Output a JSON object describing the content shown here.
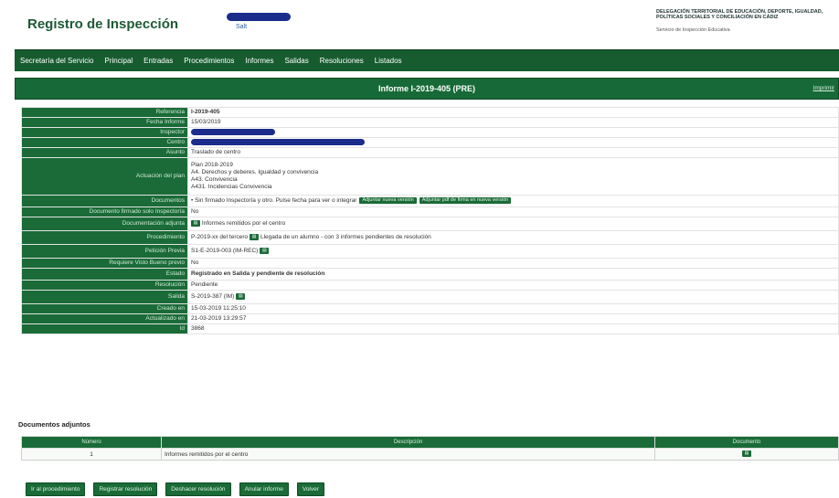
{
  "app": {
    "title": "Registro de Inspección",
    "logo_text": "Salt",
    "org_name": "DELEGACIÓN TERRITORIAL DE EDUCACIÓN, DEPORTE, IGUALDAD, POLÍTICAS SOCIALES Y CONCILIACIÓN EN CÁDIZ",
    "org_sub": "Servicio de Inspección Educativa"
  },
  "nav": [
    "Secretaría del Servicio",
    "Principal",
    "Entradas",
    "Procedimientos",
    "Informes",
    "Salidas",
    "Resoluciones",
    "Listados"
  ],
  "report": {
    "title": "Informe I-2019-405 (PRE)",
    "header_link": "Imprimir"
  },
  "fields": {
    "referencia": {
      "label": "Referencia",
      "value": "I-2019-405"
    },
    "fecha": {
      "label": "Fecha Informe",
      "value": "15/03/2019"
    },
    "inspector": {
      "label": "Inspector"
    },
    "centro": {
      "label": "Centro"
    },
    "asunto": {
      "label": "Asunto",
      "value": "Traslado de centro"
    },
    "actuacion": {
      "label": "Actuación del plan",
      "lines": [
        "Plan 2018-2019",
        "A4. Derechos y deberes. Igualdad y convivencia",
        "A43. Convivencia",
        "A431. Incidencias Convivencia"
      ]
    },
    "documentos": {
      "label": "Documentos",
      "value": "• Sin firmado Inspectoría y otro. Pulse fecha para ver o integrar",
      "btn1": "Adjuntar nueva versión",
      "btn2": "Adjuntar pdf de firma en nueva versión"
    },
    "doc_firmado": {
      "label": "Documento firmado solo Inspectoría",
      "value": "No"
    },
    "doc_adjuntos": {
      "label": "Documentación adjunta",
      "value": "Informes remitidos por el centro"
    },
    "procedimiento": {
      "label": "Procedimiento",
      "value": "P-2019-xx del tercero",
      "tail": "Llegada de un alumno - con 3 informes pendientes de resolución"
    },
    "peticion": {
      "label": "Petición Previa",
      "value": "S1-E-2019-003 (IM-REC)"
    },
    "visto_bueno": {
      "label": "Requiere Visto Bueno previo",
      "value": "No"
    },
    "estado": {
      "label": "Estado",
      "value": "Registrado en Salida y pendiente de resolución"
    },
    "resolucion": {
      "label": "Resolución",
      "value": "Pendiente"
    },
    "salida": {
      "label": "Salida",
      "value": "S-2019-387 (IM)"
    },
    "creado": {
      "label": "Creado en",
      "value": "15-03-2019 11:25:10"
    },
    "actualizado": {
      "label": "Actualizado en",
      "value": "21-03-2019 13:29:57"
    },
    "id": {
      "label": "Id",
      "value": "3868"
    }
  },
  "attachments": {
    "title": "Documentos adjuntos",
    "columns": [
      "Número",
      "Descripción",
      "Documento"
    ],
    "rows": [
      {
        "numero": "1",
        "descripcion": "Informes remitidos por el centro"
      }
    ]
  },
  "actions": [
    "Ir al procedimiento",
    "Registrar resolución",
    "Deshacer resolución",
    "Anular informe",
    "Volver"
  ],
  "colors": {
    "primary": "#1a6b37",
    "nav": "#165c2f",
    "redaction": "#1b2c8a"
  }
}
